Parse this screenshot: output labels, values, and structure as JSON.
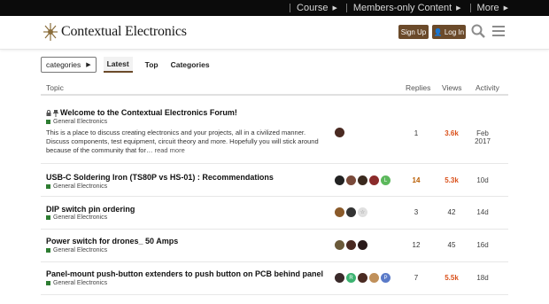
{
  "topnav": {
    "items": [
      {
        "label": "Course"
      },
      {
        "label": "Members-only Content"
      },
      {
        "label": "More"
      }
    ]
  },
  "header": {
    "logo_text": "Contextual Electronics",
    "signup_label": "Sign Up",
    "login_label": "Log In"
  },
  "nav": {
    "dropdown_label": "categories",
    "tabs": [
      {
        "label": "Latest",
        "active": true
      },
      {
        "label": "Top"
      },
      {
        "label": "Categories"
      }
    ]
  },
  "table": {
    "headers": {
      "topic": "Topic",
      "replies": "Replies",
      "views": "Views",
      "activity": "Activity"
    },
    "rows": [
      {
        "title": "Welcome to the Contextual Electronics Forum!",
        "category": "General Electronics",
        "excerpt": "This is a place to discuss creating electronics and your projects, all in a civilized manner. Discuss components, test equipment, circuit theory and more. Hopefully you will stick around because of the community that for…",
        "read_more": "read more",
        "replies": "1",
        "views": "3.6k",
        "activity": "Feb 2017"
      },
      {
        "title": "USB-C Soldering Iron (TS80P vs HS-01) : Recommendations",
        "category": "General Electronics",
        "replies": "14",
        "views": "5.3k",
        "activity": "10d"
      },
      {
        "title": "DIP switch pin ordering",
        "category": "General Electronics",
        "replies": "3",
        "views": "42",
        "activity": "14d"
      },
      {
        "title": "Power switch for drones_ 50 Amps",
        "category": "General Electronics",
        "replies": "12",
        "views": "45",
        "activity": "16d"
      },
      {
        "title": "Panel-mount push-button extenders to push button on PCB behind panel",
        "category": "General Electronics",
        "replies": "7",
        "views": "5.5k",
        "activity": "18d"
      }
    ]
  },
  "colors": {
    "brand_brown": "#6b4a2a",
    "category_green": "#2e7d32",
    "hot_views": "#d9501a"
  }
}
